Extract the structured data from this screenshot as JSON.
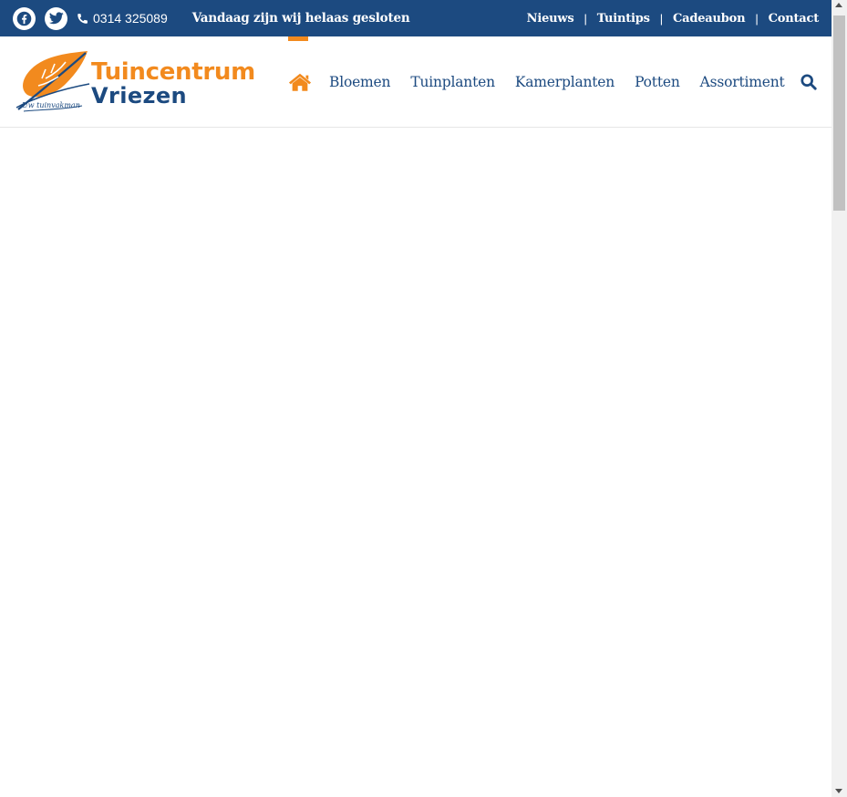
{
  "colors": {
    "primary": "#1c4a80",
    "accent": "#f28a1e",
    "background": "#ffffff"
  },
  "topbar": {
    "social": [
      {
        "icon": "facebook-icon"
      },
      {
        "icon": "twitter-icon"
      }
    ],
    "phone": "0314 325089",
    "status": "Vandaag zijn wij helaas gesloten",
    "links": [
      "Nieuws",
      "Tuintips",
      "Cadeaubon",
      "Contact"
    ]
  },
  "logo": {
    "line1": "Tuincentrum",
    "line2": "Vriezen",
    "tagline": "Uw tuinvakman"
  },
  "nav": {
    "home_icon": "home-icon",
    "items": [
      "Bloemen",
      "Tuinplanten",
      "Kamerplanten",
      "Potten",
      "Assortiment"
    ],
    "search_icon": "search-icon"
  }
}
